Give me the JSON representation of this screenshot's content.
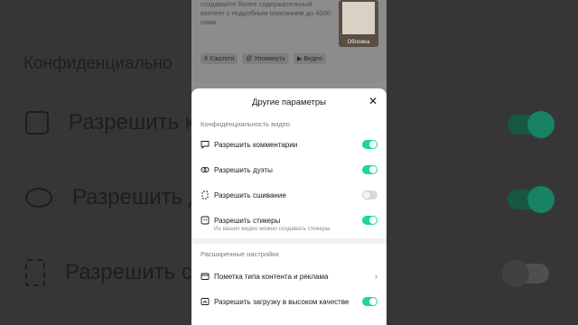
{
  "background": {
    "heading": "Конфиденциально",
    "rows": [
      {
        "label": "Разрешить ко",
        "state": "on"
      },
      {
        "label": "Разрешить д",
        "state": "on"
      },
      {
        "label": "Разрешить с",
        "state": "off"
      }
    ]
  },
  "editor": {
    "description": "создавайте более содержательный контент с подробным описанием до 4000 симв.",
    "cover_label": "Обложка",
    "chips": [
      {
        "icon": "hash-icon",
        "label": "Хэштеги"
      },
      {
        "icon": "at-icon",
        "label": "Упомянуть"
      },
      {
        "icon": "play-icon",
        "label": "Видео"
      }
    ]
  },
  "sheet": {
    "title": "Другие параметры",
    "privacy_section": "Конфиденциальность видео",
    "privacy_items": [
      {
        "icon": "comment-icon",
        "label": "Разрешить комментарии",
        "enabled": true
      },
      {
        "icon": "duet-icon",
        "label": "Разрешить дуэты",
        "enabled": true
      },
      {
        "icon": "stitch-icon",
        "label": "Разрешить сшивание",
        "enabled": false
      },
      {
        "icon": "sticker-icon",
        "label": "Разрешить стикеры",
        "enabled": true
      }
    ],
    "sticker_hint": "Из ваших видео можно создавать стикеры",
    "advanced_section": "Расширенные настройки",
    "advanced_items": [
      {
        "icon": "tag-icon",
        "label": "Пометка типа контента и реклама"
      },
      {
        "icon": "hd-icon",
        "label": "Разрешить загрузку в высоком качестве",
        "enabled": true
      }
    ]
  },
  "colors": {
    "accent": "#20d5a0",
    "text": "#161823"
  }
}
